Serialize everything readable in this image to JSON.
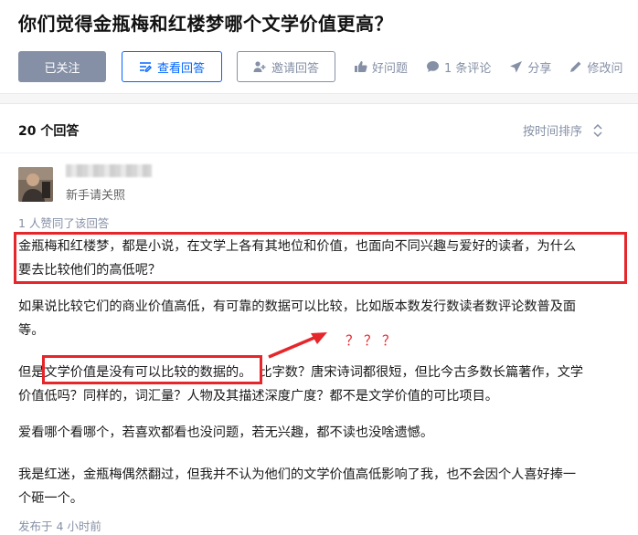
{
  "question": {
    "title": "你们觉得金瓶梅和红楼梦哪个文学价值更高？"
  },
  "actions": {
    "followed_label": "已关注",
    "view_answers_label": "查看回答",
    "invite_label": "邀请回答",
    "good_question_label": "好问题",
    "comments_label": "1 条评论",
    "share_label": "分享",
    "edit_label": "修改问"
  },
  "answers": {
    "count_label": "20 个回答",
    "sort_label": "按时间排序"
  },
  "answer": {
    "author_bio": "新手请关照",
    "votes_text": "1 人赞同了该回答",
    "para1_line1": "金瓶梅和红楼梦，都是小说，在文学上各有其地位和价值，也面向不同兴趣与爱好的读者，为什么",
    "para1_line2": "要去比较他们的高低呢？",
    "para2_line1": "如果说比较它们的商业价值高低，有可靠的数据可以比较，比如版本数发行数读者数评论数普及面",
    "para2_line2": "等。",
    "para3_prefix": "但是",
    "para3_highlight": "文学价值是没有可以比较的数据的。",
    "para3_line1_rest": "比字数？唐宋诗词都很短，但比今古多数长篇著作，文学",
    "para3_line2": "价值低吗？同样的，词汇量？人物及其描述深度广度？都不是文学价值的可比项目。",
    "para4": "爱看哪个看哪个，若喜欢都看也没问题，若无兴趣，都不读也没啥遗憾。",
    "para5_line1": "我是红迷，金瓶梅偶然翻过，但我并不认为他们的文学价值高低影响了我，也不会因个人喜好捧一",
    "para5_line2": "个砸一个。",
    "publish_time": "发布于 4 小时前"
  },
  "annotation": {
    "question_marks": "？？？"
  },
  "colors": {
    "brand_blue": "#0066ff",
    "muted": "#8590a6",
    "annotation_red": "#e5262b"
  },
  "icons": [
    "pen-icon",
    "add-user-icon",
    "thumbs-up-icon",
    "comment-icon",
    "share-icon",
    "edit-icon",
    "sort-icon"
  ]
}
